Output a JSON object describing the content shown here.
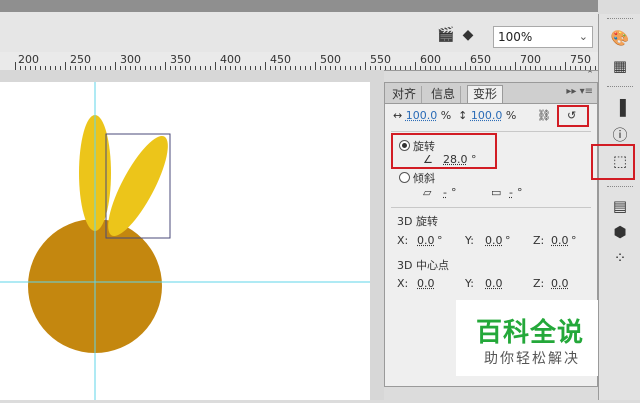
{
  "toolbar": {
    "zoom_value": "100%",
    "tools": [
      "clapperboard-icon",
      "paint-bucket-icon"
    ]
  },
  "ruler": {
    "ticks": [
      "200",
      "250",
      "300",
      "350",
      "400",
      "450",
      "500",
      "550",
      "600",
      "650",
      "700",
      "750"
    ]
  },
  "panel": {
    "tabs": [
      "对齐",
      "信息",
      "变形"
    ],
    "active_tab": "变形",
    "scale_w": "100.0",
    "scale_h": "100.0",
    "percent": "%",
    "rotate_label": "旋转",
    "rotate_value": "28.0",
    "degree": "°",
    "skew_label": "倾斜",
    "skew_h": "-",
    "skew_v": "-",
    "rotate3d_label": "3D 旋转",
    "center3d_label": "3D 中心点",
    "x_label": "X:",
    "y_label": "Y:",
    "z_label": "Z:",
    "rot3d_x": "0.0",
    "rot3d_y": "0.0",
    "rot3d_z": "0.0",
    "c3d_x": "0.0",
    "c3d_y": "0.0",
    "c3d_z": "0.0"
  },
  "watermark": {
    "title": "百科全说",
    "subtitle": "助你轻松解决"
  },
  "colors": {
    "body": "#c4870f",
    "ear": "#ecc51a",
    "highlight": "#d21c24",
    "guide": "#5fd6e8"
  }
}
